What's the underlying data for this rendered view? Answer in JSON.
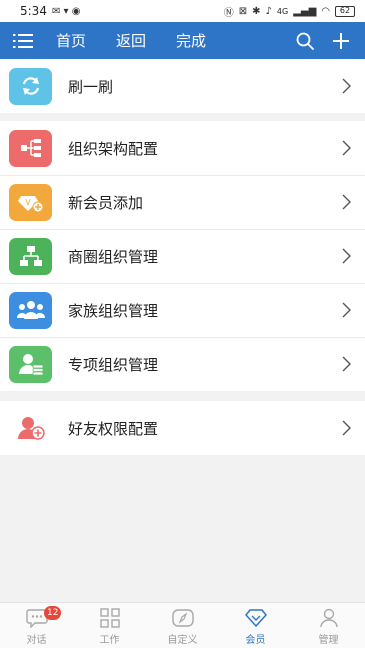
{
  "status_bar": {
    "time": "5:34",
    "network": "4G",
    "battery": "62"
  },
  "topbar": {
    "nav": [
      "首页",
      "返回",
      "完成"
    ]
  },
  "menu": {
    "group1": [
      {
        "label": "刷一刷",
        "icon": "refresh-icon",
        "color": "#5ec3e6"
      }
    ],
    "group2": [
      {
        "label": "组织架构配置",
        "icon": "org-chart-icon",
        "color": "#ee6b6b"
      },
      {
        "label": "新会员添加",
        "icon": "new-member-icon",
        "color": "#f3a83b"
      },
      {
        "label": "商圈组织管理",
        "icon": "business-circle-icon",
        "color": "#4cb35a"
      },
      {
        "label": "家族组织管理",
        "icon": "family-icon",
        "color": "#3d8ee0"
      },
      {
        "label": "专项组织管理",
        "icon": "special-org-icon",
        "color": "#5cbf6a"
      }
    ],
    "group3": [
      {
        "label": "好友权限配置",
        "icon": "friend-permission-icon",
        "color": "#ee6b6b"
      }
    ]
  },
  "tabbar": {
    "tabs": [
      {
        "label": "对话",
        "icon": "chat-icon"
      },
      {
        "label": "工作",
        "icon": "work-grid-icon"
      },
      {
        "label": "自定义",
        "icon": "custom-compass-icon"
      },
      {
        "label": "会员",
        "icon": "member-diamond-icon"
      },
      {
        "label": "管理",
        "icon": "manage-person-icon"
      }
    ],
    "active": "会员",
    "chat_badge": "12"
  },
  "colors": {
    "primary": "#2f75c7",
    "background": "#f2f2f2",
    "badge": "#e8463b"
  }
}
